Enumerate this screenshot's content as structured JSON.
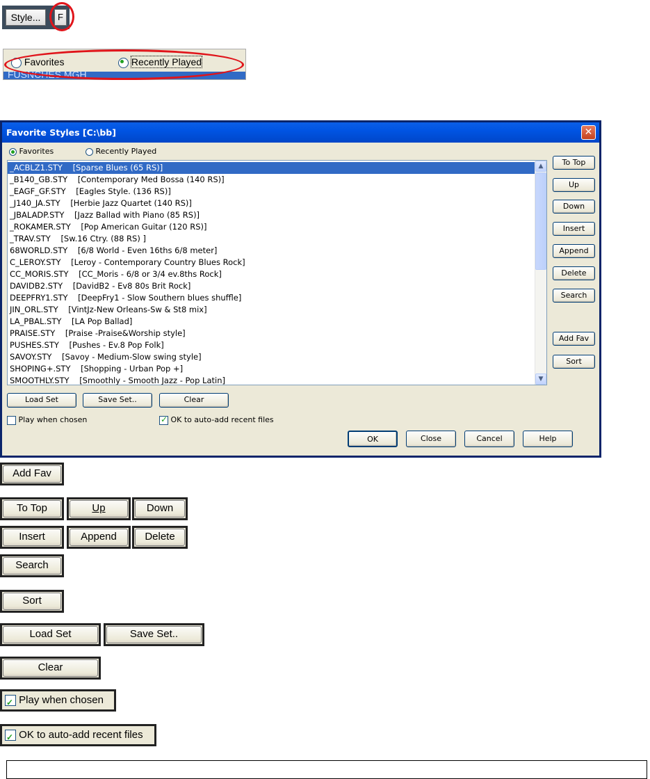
{
  "top": {
    "style_button": "Style...",
    "f_button": "F",
    "radio_favorites": "Favorites",
    "radio_recent": "Recently Played",
    "list_fragment": "FUSNCHES MGH"
  },
  "dialog": {
    "title": "Favorite Styles [C:\\bb]",
    "radio_favorites": "Favorites",
    "radio_recent": "Recently Played",
    "items": [
      "_ACBLZ1.STY    [Sparse Blues (65 RS)]",
      "_B140_GB.STY    [Contemporary Med Bossa (140 RS)]",
      "_EAGF_GF.STY    [Eagles Style. (136 RS)]",
      "_J140_JA.STY    [Herbie Jazz Quartet (140 RS)]",
      "_JBALADP.STY    [Jazz Ballad with Piano (85 RS)]",
      "_ROKAMER.STY    [Pop American Guitar (120 RS)]",
      "_TRAV.STY    [Sw.16 Ctry. (88 RS) ]",
      "68WORLD.STY    [6/8 World - Even 16ths 6/8 meter]",
      "C_LEROY.STY    [Leroy - Contemporary Country Blues Rock]",
      "CC_MORIS.STY    [CC_Moris - 6/8 or 3/4 ev.8ths Rock]",
      "DAVIDB2.STY    [DavidB2 - Ev8 80s Brit Rock]",
      "DEEPFRY1.STY    [DeepFry1 - Slow Southern blues shuffle]",
      "JIN_ORL.STY    [VintJz-New Orleans-Sw & St8 mix]",
      "LA_PBAL.STY    [LA Pop Ballad]",
      "PRAISE.STY    [Praise -Praise&Worship style]",
      "PUSHES.STY    [Pushes - Ev.8 Pop Folk]",
      "SAVOY.STY    [Savoy - Medium-Slow swing style]",
      "SHOPING+.STY    [Shopping - Urban Pop +]",
      "SMOOTHLY.STY    [Smoothly - Smooth Jazz - Pop Latin]"
    ],
    "side_buttons": [
      "To Top",
      "Up",
      "Down",
      "Insert",
      "Append",
      "Delete",
      "Search"
    ],
    "add_fav": "Add Fav",
    "sort": "Sort",
    "load_set": "Load Set",
    "save_set": "Save Set..",
    "clear": "Clear",
    "play_when_chosen": "Play when chosen",
    "ok_auto_add": "OK to auto-add recent files",
    "ok": "OK",
    "close": "Close",
    "cancel": "Cancel",
    "help": "Help"
  },
  "callouts": {
    "add_fav": "Add Fav",
    "to_top": "To Top",
    "up": "Up",
    "down": "Down",
    "insert": "Insert",
    "append": "Append",
    "delete": "Delete",
    "search": "Search",
    "sort": "Sort",
    "load_set": "Load Set",
    "save_set": "Save Set..",
    "clear": "Clear",
    "play_when_chosen": "Play when chosen",
    "ok_auto_add": "OK to auto-add recent files"
  },
  "colors": {
    "title_bar": "#0a246a",
    "selection": "#316ac5",
    "highlight_ring": "#e0141a"
  }
}
